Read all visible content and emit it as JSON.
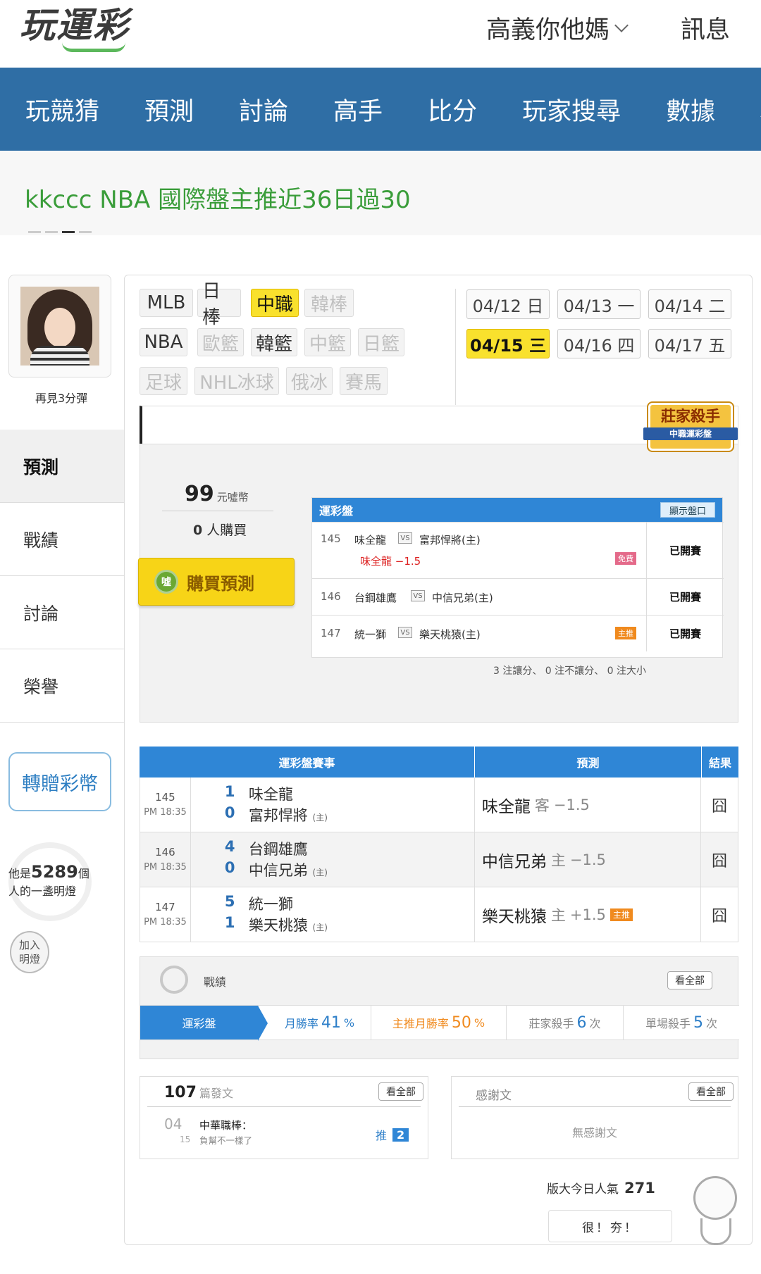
{
  "header": {
    "logo": "玩運彩",
    "user": "高義你他媽",
    "messages": "訊息"
  },
  "nav": [
    "玩競猜",
    "預測",
    "討論",
    "高手",
    "比分",
    "玩家搜尋",
    "數據",
    "AP"
  ],
  "banner": {
    "text": "kkccc NBA 國際盤主推近36日過30"
  },
  "profile": {
    "name": "再見3分彈"
  },
  "sidebar": [
    {
      "label": "預測",
      "active": true
    },
    {
      "label": "戰績",
      "active": false
    },
    {
      "label": "討論",
      "active": false
    },
    {
      "label": "榮譽",
      "active": false
    }
  ],
  "gift": "轉贈彩幣",
  "lamp": {
    "prefix": "他是",
    "count": "5289",
    "suffix": "個",
    "line2": "人的一盞明燈",
    "join1": "加入",
    "join2": "明燈"
  },
  "sports": [
    {
      "label": "MLB",
      "state": "normal"
    },
    {
      "label": "日棒",
      "state": "normal"
    },
    {
      "label": "中職",
      "state": "selected"
    },
    {
      "label": "韓棒",
      "state": "dim"
    },
    {
      "label": "NBA",
      "state": "normal"
    },
    {
      "label": "歐籃",
      "state": "dim"
    },
    {
      "label": "韓籃",
      "state": "normal"
    },
    {
      "label": "中籃",
      "state": "dim"
    },
    {
      "label": "日籃",
      "state": "dim"
    },
    {
      "label": "足球",
      "state": "dim"
    },
    {
      "label": "NHL冰球",
      "state": "dim"
    },
    {
      "label": "俄冰",
      "state": "dim"
    },
    {
      "label": "賽馬",
      "state": "dim"
    }
  ],
  "dates": [
    {
      "label": "04/12 日",
      "selected": false
    },
    {
      "label": "04/13 一",
      "selected": false
    },
    {
      "label": "04/14 二",
      "selected": false
    },
    {
      "label": "04/15 三",
      "selected": true
    },
    {
      "label": "04/16 四",
      "selected": false
    },
    {
      "label": "04/17 五",
      "selected": false
    }
  ],
  "killer_badge": {
    "title": "莊家殺手",
    "sub": "中職運彩盤"
  },
  "purchase": {
    "price": "99",
    "unit": "元噓幣",
    "buyers": "0",
    "buyers_label": "人購買",
    "button": "購買預測",
    "button_icon": "噓"
  },
  "odds": {
    "title": "運彩盤",
    "show_button": "顯示盤口",
    "rows": [
      {
        "num": "145",
        "away": "味全龍",
        "vs": "VS",
        "home": "富邦悍將(主)",
        "line": "味全龍 −1.5",
        "badge": "免費",
        "status": "已開賽"
      },
      {
        "num": "146",
        "away": "台鋼雄鷹",
        "vs": "VS",
        "home": "中信兄弟(主)",
        "line": "",
        "badge": "",
        "status": "已開賽"
      },
      {
        "num": "147",
        "away": "統一獅",
        "vs": "VS",
        "home": "樂天桃猿(主)",
        "line": "",
        "badge": "主推",
        "status": "已開賽"
      }
    ],
    "summary": "3 注讓分、 0 注不讓分、 0 注大小"
  },
  "results": {
    "headers": [
      "運彩盤賽事",
      "預測",
      "結果"
    ],
    "rows": [
      {
        "num": "145",
        "time": "PM 18:35",
        "s1": "1",
        "t1": "味全龍",
        "s2": "0",
        "t2": "富邦悍將",
        "home": "(主)",
        "pick": "味全龍",
        "side": "客",
        "line": "−1.5",
        "badge": "",
        "result": "囧"
      },
      {
        "num": "146",
        "time": "PM 18:35",
        "s1": "4",
        "t1": "台鋼雄鷹",
        "s2": "0",
        "t2": "中信兄弟",
        "home": "(主)",
        "pick": "中信兄弟",
        "side": "主",
        "line": "−1.5",
        "badge": "",
        "result": "囧"
      },
      {
        "num": "147",
        "time": "PM 18:35",
        "s1": "5",
        "t1": "統一獅",
        "s2": "1",
        "t2": "樂天桃猿",
        "home": "(主)",
        "pick": "樂天桃猿",
        "side": "主",
        "line": "+1.5",
        "badge": "主推",
        "result": "囧"
      }
    ]
  },
  "record": {
    "title": "戰績",
    "see_all": "看全部",
    "tab": "運彩盤",
    "stats": [
      {
        "label": "月勝率",
        "value": "41",
        "unit": "%",
        "color": "#2c7ec8"
      },
      {
        "label": "主推月勝率",
        "value": "50",
        "unit": "%",
        "color": "#f08a1e"
      },
      {
        "label": "莊家殺手",
        "value": "6",
        "unit": "次",
        "color": "#2c7ec8"
      },
      {
        "label": "單場殺手",
        "value": "5",
        "unit": "次",
        "color": "#2c7ec8"
      }
    ]
  },
  "posts": {
    "count": "107",
    "label": "篇發文",
    "see_all": "看全部",
    "date_m": "04",
    "date_d": "15",
    "title": "中華職棒：",
    "subtitle": "負幫不一樣了",
    "push_label": "推",
    "push_count": "2"
  },
  "thanks": {
    "label": "感謝文",
    "see_all": "看全部",
    "empty": "無感謝文"
  },
  "popularity": {
    "label": "版大今日人氣",
    "value": "271",
    "speech": "很！夯！"
  }
}
